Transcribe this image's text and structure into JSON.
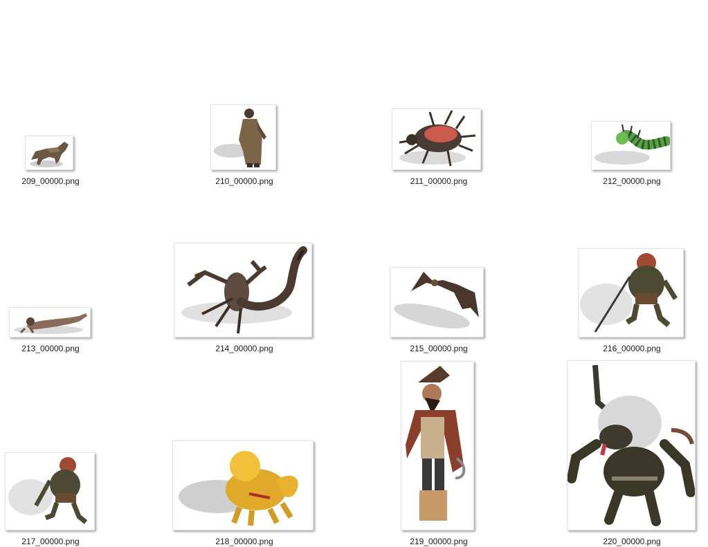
{
  "files": [
    {
      "name": "209_00000.png",
      "icon": "wolf-thumbnail"
    },
    {
      "name": "210_00000.png",
      "icon": "robed-monk-thumbnail"
    },
    {
      "name": "211_00000.png",
      "icon": "giant-beetle-thumbnail"
    },
    {
      "name": "212_00000.png",
      "icon": "green-caterpillar-thumbnail"
    },
    {
      "name": "213_00000.png",
      "icon": "crawling-zombie-thumbnail"
    },
    {
      "name": "214_00000.png",
      "icon": "scorpion-thumbnail"
    },
    {
      "name": "215_00000.png",
      "icon": "bat-thumbnail"
    },
    {
      "name": "216_00000.png",
      "icon": "goblin-spearman-thumbnail"
    },
    {
      "name": "217_00000.png",
      "icon": "goblin-thumbnail"
    },
    {
      "name": "218_00000.png",
      "icon": "golden-lion-thumbnail"
    },
    {
      "name": "219_00000.png",
      "icon": "pirate-captain-thumbnail"
    },
    {
      "name": "220_00000.png",
      "icon": "horned-demon-thumbnail"
    }
  ]
}
